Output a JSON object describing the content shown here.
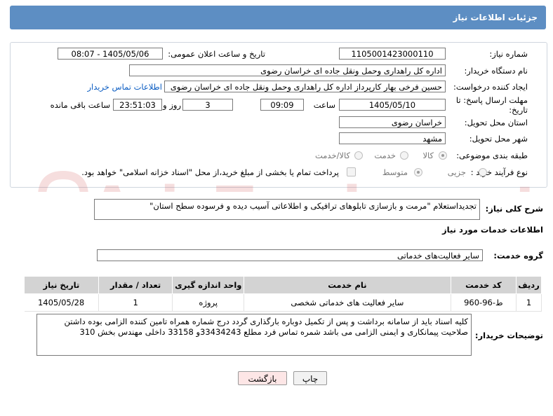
{
  "header": {
    "title": "جزئیات اطلاعات نیاز"
  },
  "fields": {
    "need_number_label": "شماره نیاز:",
    "need_number": "1105001423000110",
    "announce_label": "تاریخ و ساعت اعلان عمومی:",
    "announce_value": "1405/05/06 - 08:07",
    "buyer_org_label": "نام دستگاه خریدار:",
    "buyer_org": "اداره کل راهداری وحمل ونقل جاده ای خراسان رضوی",
    "creator_label": "ایجاد کننده درخواست:",
    "creator": "حسین فرخی بهار کارپرداز اداره کل راهداری وحمل ونقل جاده ای خراسان رضوی",
    "contact_link": "اطلاعات تماس خریدار",
    "deadline_label_1": "مهلت ارسال پاسخ: تا",
    "deadline_label_2": "تاریخ:",
    "deadline_date": "1405/05/10",
    "time_label": "ساعت",
    "deadline_time": "09:09",
    "days_value": "3",
    "days_label": "روز و",
    "remaining_value": "23:51:03",
    "remaining_label": "ساعت باقی مانده",
    "province_label": "استان محل تحویل:",
    "province": "خراسان رضوی",
    "city_label": "شهر محل تحویل:",
    "city": "مشهد",
    "category_label": "طبقه بندی موضوعی:",
    "category_options": [
      "کالا",
      "خدمت",
      "کالا/خدمت"
    ],
    "purchase_label": "نوع فرآیند خرید :",
    "purchase_options": [
      "جزیی",
      "متوسط"
    ],
    "payment_note": "پرداخت تمام یا بخشی از مبلغ خرید،از محل \"اسناد خزانه اسلامی\" خواهد بود."
  },
  "summary": {
    "label": "شرح کلی نیاز:",
    "text": "تجدیداستعلام \"مرمت و بازسازی تابلوهای ترافیکی و اطلاعاتی آسیب دیده و فرسوده سطح استان\""
  },
  "services": {
    "section_title": "اطلاعات خدمات مورد نیاز",
    "group_label": "گروه خدمت:",
    "group_value": "سایر فعالیت‌های خدماتی",
    "columns": [
      "ردیف",
      "کد خدمت",
      "نام خدمت",
      "واحد اندازه گیری",
      "تعداد / مقدار",
      "تاریخ نیاز"
    ],
    "rows": [
      {
        "row": "1",
        "code": "ط-96-960",
        "name": "سایر فعالیت های خدماتی شخصی",
        "unit": "پروژه",
        "qty": "1",
        "date": "1405/05/28"
      }
    ]
  },
  "buyer_notes": {
    "label": "توضیحات خریدار:",
    "line1": "کلیه اسناد باید از سامانه برداشت و پس از تکمیل دوباره بارگذاری گردد درج شماره همراه تامین کننده الزامی بوده داشتن",
    "line2": "صلاحیت پیمانکاری و ایمنی الزامی می باشد  شمره تماس فرد مطلع 33434243و 33158 داخلی  مهندس بخش 310"
  },
  "buttons": {
    "print": "چاپ",
    "back": "بازگشت"
  },
  "watermark": "AriaTender.net",
  "colors": {
    "header_bg": "#5d8ec3",
    "link": "#0a5cc2",
    "back_bg": "#fde6e6",
    "watermark": "#c62828"
  }
}
